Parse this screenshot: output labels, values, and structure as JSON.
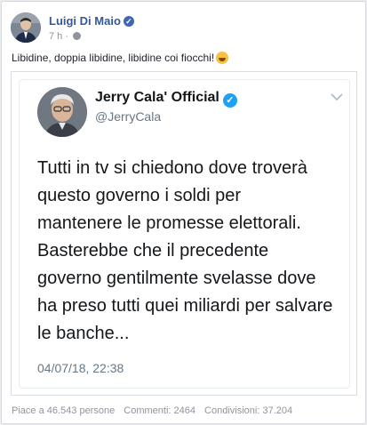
{
  "post": {
    "author": "Luigi Di Maio",
    "time": "7 h",
    "separator": "·",
    "verified_icon": "verified-badge-icon",
    "privacy_icon": "globe-icon",
    "text": "Libidine, doppia libidine, libidine coi fiocchi!",
    "emoji": "grinning-face-emoji"
  },
  "tweet": {
    "name": "Jerry Cala' Official",
    "handle": "@JerryCala",
    "verified_icon": "verified-badge-icon",
    "menu_icon": "chevron-down-icon",
    "body_lines": [
      "Tutti in tv si chiedono dove troverà",
      "questo governo i soldi per",
      "mantenere le promesse elettorali.",
      "Basterebbe che il precedente",
      "governo gentilmente svelasse dove",
      "ha preso tutti quei miliardi per salvare",
      "le banche..."
    ],
    "date": "04/07/18, 22:38"
  },
  "stats": {
    "likes": "Piace a 46.543 persone",
    "comments": "Commenti: 2464",
    "shares": "Condivisioni: 37.204"
  },
  "colors": {
    "fb_link": "#365899",
    "twitter_blue": "#1da1f2",
    "muted": "#90949c"
  }
}
